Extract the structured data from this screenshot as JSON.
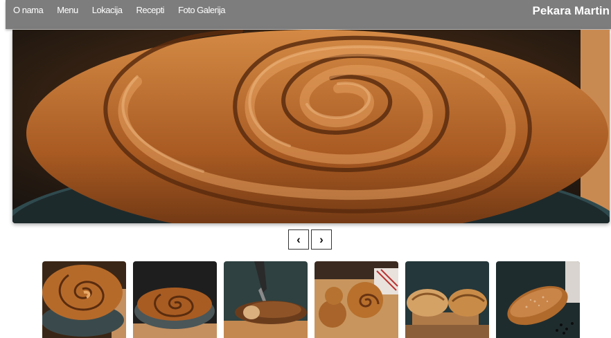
{
  "navbar": {
    "links": [
      "O nama",
      "Menu",
      "Lokacija",
      "Recepti",
      "Foto Galerija"
    ],
    "brand": "Pekara Martin"
  },
  "carousel": {
    "prev_label": "‹",
    "next_label": "›",
    "slide_icon": "burek-pie-image",
    "thumbnails": [
      {
        "icon": "pie-in-pan-image"
      },
      {
        "icon": "pie-in-pan-image"
      },
      {
        "icon": "bread-slicing-image"
      },
      {
        "icon": "pastries-on-board-image"
      },
      {
        "icon": "bread-rolls-image"
      },
      {
        "icon": "loaf-image"
      }
    ]
  },
  "colors": {
    "navbar": "#7d7d7d",
    "nav_text": "#ffffff",
    "crust": "#b8682a"
  }
}
